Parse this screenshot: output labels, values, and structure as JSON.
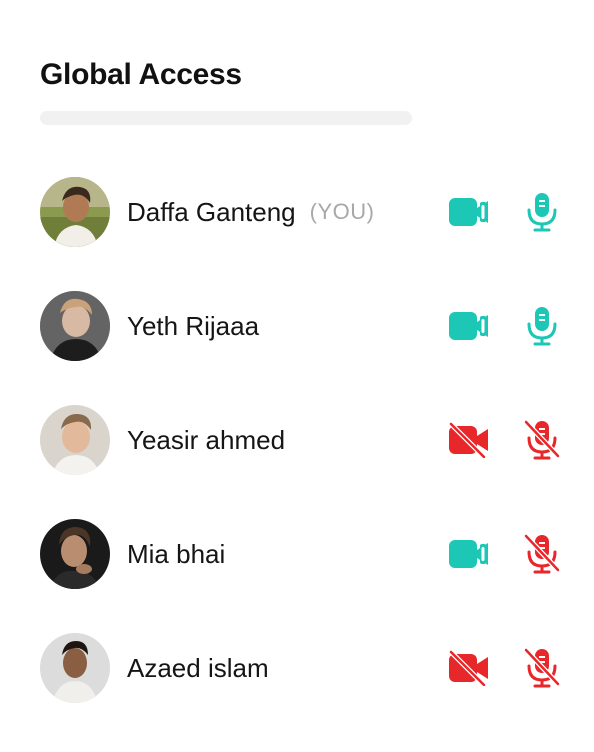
{
  "header": {
    "title": "Global Access"
  },
  "colors": {
    "active": "#1cc7b5",
    "muted": "#e8272b",
    "search_bg": "#f1f1f1"
  },
  "participants": [
    {
      "name": "Daffa Ganteng",
      "tag": "(YOU)",
      "camera": "on",
      "mic": "on"
    },
    {
      "name": "Yeth Rijaaa",
      "camera": "on",
      "mic": "on"
    },
    {
      "name": "Yeasir ahmed",
      "camera": "off",
      "mic": "off"
    },
    {
      "name": "Mia bhai",
      "camera": "on",
      "mic": "off"
    },
    {
      "name": "Azaed islam",
      "camera": "off",
      "mic": "off"
    }
  ]
}
